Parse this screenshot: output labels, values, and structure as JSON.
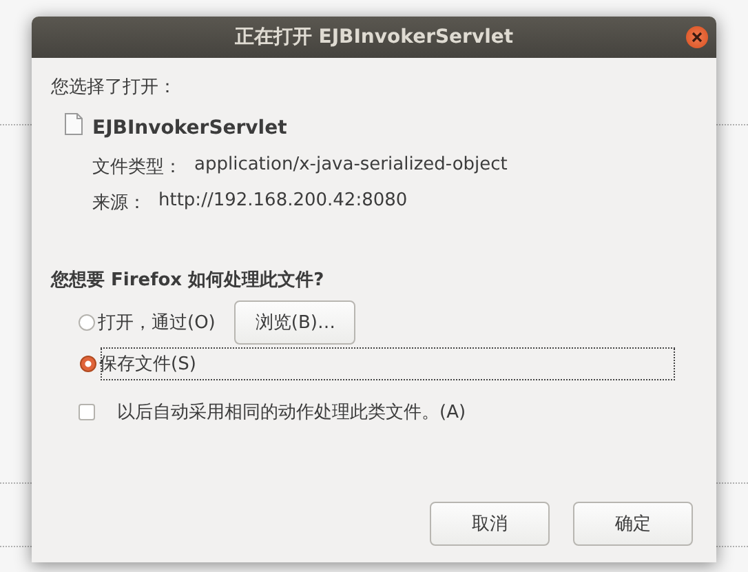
{
  "window": {
    "title": "正在打开 EJBInvokerServlet"
  },
  "intro": "您选择了打开：",
  "file": {
    "name": "EJBInvokerServlet",
    "type_label": "文件类型：",
    "type": "application/x-java-serialized-object",
    "source_label": "来源：",
    "source": "http://192.168.200.42:8080"
  },
  "question": "您想要 Firefox 如何处理此文件?",
  "options": [
    {
      "kind": "radio",
      "label": "打开，通过(O)",
      "selected": false,
      "button": "浏览(B)…"
    },
    {
      "kind": "radio",
      "label": "保存文件(S)",
      "selected": true
    }
  ],
  "remember": {
    "label": "以后自动采用相同的动作处理此类文件。(A)",
    "checked": false
  },
  "buttons": [
    "取消",
    "确定"
  ]
}
